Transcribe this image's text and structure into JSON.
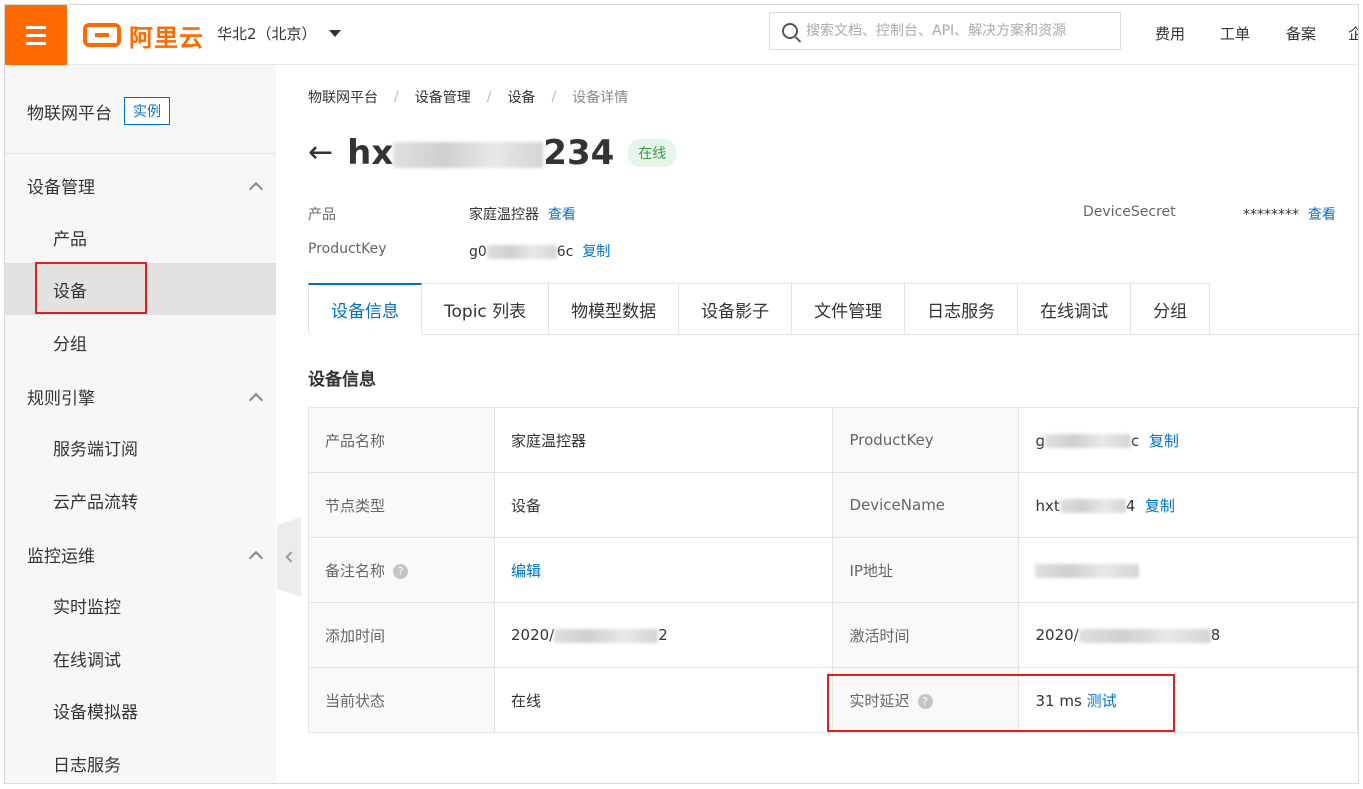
{
  "topbar": {
    "brand": "阿里云",
    "region": "华北2（北京）",
    "search_placeholder": "搜索文档、控制台、API、解决方案和资源",
    "links": [
      "费用",
      "工单",
      "备案",
      "企"
    ]
  },
  "sidebar": {
    "title": "物联网平台",
    "badge": "实例",
    "groups": [
      {
        "label": "设备管理",
        "items": [
          "产品",
          "设备",
          "分组"
        ]
      },
      {
        "label": "规则引擎",
        "items": [
          "服务端订阅",
          "云产品流转"
        ]
      },
      {
        "label": "监控运维",
        "items": [
          "实时监控",
          "在线调试",
          "设备模拟器",
          "日志服务"
        ]
      }
    ],
    "active_item": "设备"
  },
  "breadcrumb": [
    "物联网平台",
    "设备管理",
    "设备",
    "设备详情"
  ],
  "device": {
    "title_prefix": "hx",
    "title_suffix": "234",
    "status": "在线"
  },
  "meta": {
    "product_label": "产品",
    "product_value": "家庭温控器",
    "product_link": "查看",
    "productkey_label": "ProductKey",
    "productkey_prefix": "g0",
    "productkey_suffix": "6c",
    "copy_link": "复制",
    "secret_label": "DeviceSecret",
    "secret_value": "********",
    "secret_link": "查看"
  },
  "tabs": [
    "设备信息",
    "Topic 列表",
    "物模型数据",
    "设备影子",
    "文件管理",
    "日志服务",
    "在线调试",
    "分组"
  ],
  "section_title": "设备信息",
  "info_rows": {
    "r1": {
      "k1": "产品名称",
      "v1": "家庭温控器",
      "k2": "ProductKey",
      "v2_prefix": "g",
      "v2_suffix": "c",
      "v2_link": "复制"
    },
    "r2": {
      "k1": "节点类型",
      "v1": "设备",
      "k2": "DeviceName",
      "v2_prefix": "hxt",
      "v2_suffix": "4",
      "v2_link": "复制"
    },
    "r3": {
      "k1": "备注名称",
      "v1_link": "编辑",
      "k2": "IP地址"
    },
    "r4": {
      "k1": "添加时间",
      "v1_prefix": "2020/",
      "v1_suffix": "2",
      "k2": "激活时间",
      "v2_prefix": "2020/",
      "v2_suffix": "8"
    },
    "r5": {
      "k1": "当前状态",
      "v1": "在线",
      "k2": "实时延迟",
      "v2": "31 ms",
      "v2_link": "测试"
    }
  },
  "icons": {
    "menu": "hamburger-icon",
    "search": "search-icon",
    "back": "arrow-left-icon",
    "collapse": "chevron-left-icon",
    "help": "question-circle-icon"
  },
  "colors": {
    "brand": "#ff6a00",
    "link": "#0070cc",
    "online": "#3d9a4a",
    "highlight": "#e02020"
  }
}
